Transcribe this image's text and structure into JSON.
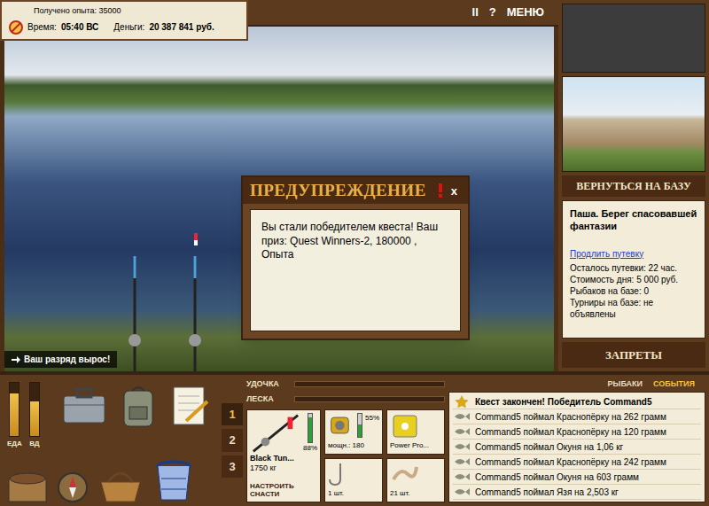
{
  "hud": {
    "experience": "Получено опыта: 35000",
    "time_label": "Время:",
    "time": "05:40 ВС",
    "money_label": "Деньги:",
    "money": "20 387 841 руб."
  },
  "top_menu": [
    "II",
    "?",
    "МЕНЮ"
  ],
  "dialog": {
    "title": "ПРЕДУПРЕЖДЕНИЕ",
    "close": "x",
    "message": "Вы стали победителем квеста! Ваш приз: Quest Winners-2, 180000 , Опыта"
  },
  "notice": {
    "text": "Ваш разряд вырос!"
  },
  "base": {
    "return_button": "ВЕРНУТЬСЯ НА БАЗУ",
    "title": "Паша. Берег спасовавшей фантазии",
    "extend_link": "Продлить путевку",
    "lines": [
      "Осталось путевки: 22 час.",
      "Стоимость дня: 5 000 руб.",
      "Рыбаков на базе: 0",
      "Турниры на базе: не объявлены"
    ],
    "bans_button": "ЗАПРЕТЫ"
  },
  "meters": [
    {
      "label": "ЕДА",
      "level": 0.8
    },
    {
      "label": "ВД",
      "level": 0.65
    }
  ],
  "slots": [
    {
      "label": "1",
      "selected": true
    },
    {
      "label": "2",
      "selected": false
    },
    {
      "label": "3",
      "selected": false
    }
  ],
  "tension_bars": [
    {
      "label": "УДОЧКА",
      "level": 0
    },
    {
      "label": "ЛЕСКА",
      "level": 0
    }
  ],
  "tackle": {
    "rod": {
      "name": "Black Tun...",
      "capacity": "1750 кг",
      "wear": "88%",
      "level": 0.88
    },
    "reel": {
      "power": "мощн.: 180",
      "wear": "55%",
      "level": 0.55
    },
    "line": {
      "name": "Power Pro..."
    },
    "hook": {
      "count": "1 шт."
    },
    "bait": {
      "count": "21 шт."
    },
    "setup_button": "НАСТРОИТЬ СНАСТИ"
  },
  "feed_tabs": [
    {
      "label": "РЫБАКИ",
      "selected": false
    },
    {
      "label": "СОБЫТИЯ",
      "selected": true
    }
  ],
  "events": [
    {
      "kind": "quest",
      "text": "Квест закончен! Победитель Command5"
    },
    {
      "kind": "catch",
      "text": "Command5 поймал Краснопёрку на 262 грамм"
    },
    {
      "kind": "catch",
      "text": "Command5 поймал Краснопёрку на 120 грамм"
    },
    {
      "kind": "catch",
      "text": "Command5 поймал Окуня на 1,06 кг"
    },
    {
      "kind": "catch",
      "text": "Command5 поймал Краснопёрку на 242 грамм"
    },
    {
      "kind": "catch",
      "text": "Command5 поймал Окуня на 603 грамм"
    },
    {
      "kind": "catch",
      "text": "Command5 поймал Язя на 2,503 кг"
    }
  ]
}
